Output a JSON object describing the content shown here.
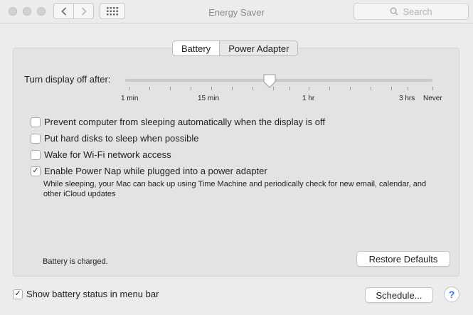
{
  "window": {
    "title": "Energy Saver"
  },
  "search": {
    "placeholder": "Search"
  },
  "tabs": [
    {
      "label": "Battery",
      "selected": true
    },
    {
      "label": "Power Adapter",
      "selected": false
    }
  ],
  "slider": {
    "label": "Turn display off after:",
    "tick_labels": [
      "1 min",
      "15 min",
      "1 hr",
      "3 hrs",
      "Never"
    ],
    "value_fraction": 0.47
  },
  "options": [
    {
      "label": "Prevent computer from sleeping automatically when the display is off",
      "checked": false
    },
    {
      "label": "Put hard disks to sleep when possible",
      "checked": false
    },
    {
      "label": "Wake for Wi-Fi network access",
      "checked": false
    },
    {
      "label": "Enable Power Nap while plugged into a power adapter",
      "checked": true
    }
  ],
  "power_nap_note": "While sleeping, your Mac can back up using Time Machine and periodically check for new email, calendar, and other iCloud updates",
  "status": "Battery is charged.",
  "buttons": {
    "restore_defaults": "Restore Defaults",
    "schedule": "Schedule...",
    "help": "?"
  },
  "menubar": {
    "label": "Show battery status in menu bar",
    "checked": true
  },
  "icons": {
    "back": "chevron-left-icon",
    "forward": "chevron-right-icon",
    "grid": "grid-icon",
    "search": "search-icon",
    "check": "checkmark-icon"
  }
}
